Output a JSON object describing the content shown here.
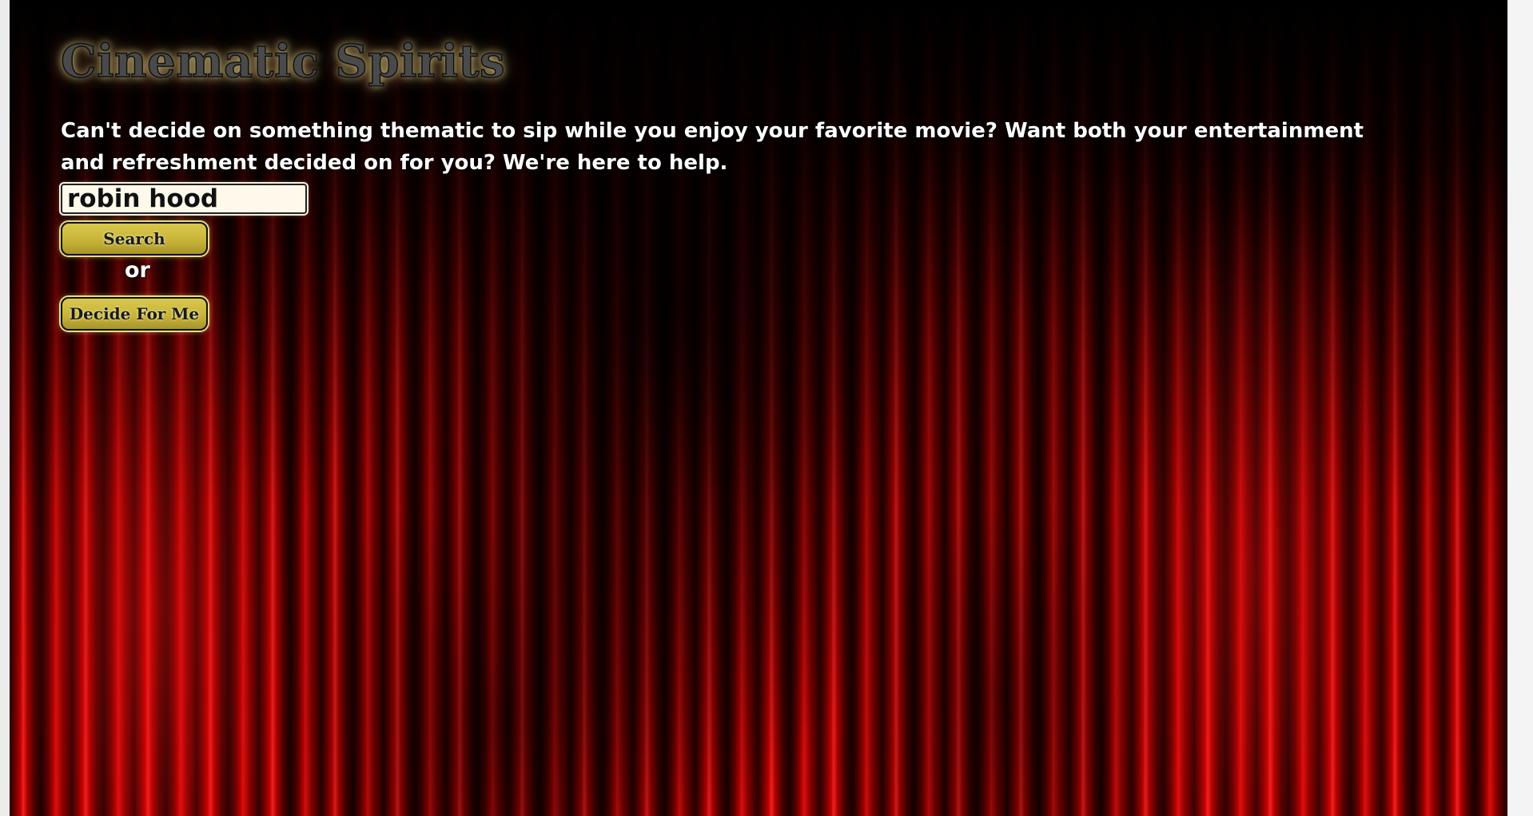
{
  "header": {
    "title": "Cinematic Spirits",
    "tagline": "Can't decide on something thematic to sip while you enjoy your favorite movie? Want both your entertainment and refreshment decided on for you? We're here to help."
  },
  "search": {
    "value": "robin hood",
    "button_label": "Search"
  },
  "separator": {
    "text": "or"
  },
  "decide": {
    "button_label": "Decide For Me"
  },
  "colors": {
    "curtain_red": "#d40000",
    "button_gold": "#c9b43a",
    "input_bg": "#fff9ec",
    "title_gray": "#4a4a4a"
  }
}
